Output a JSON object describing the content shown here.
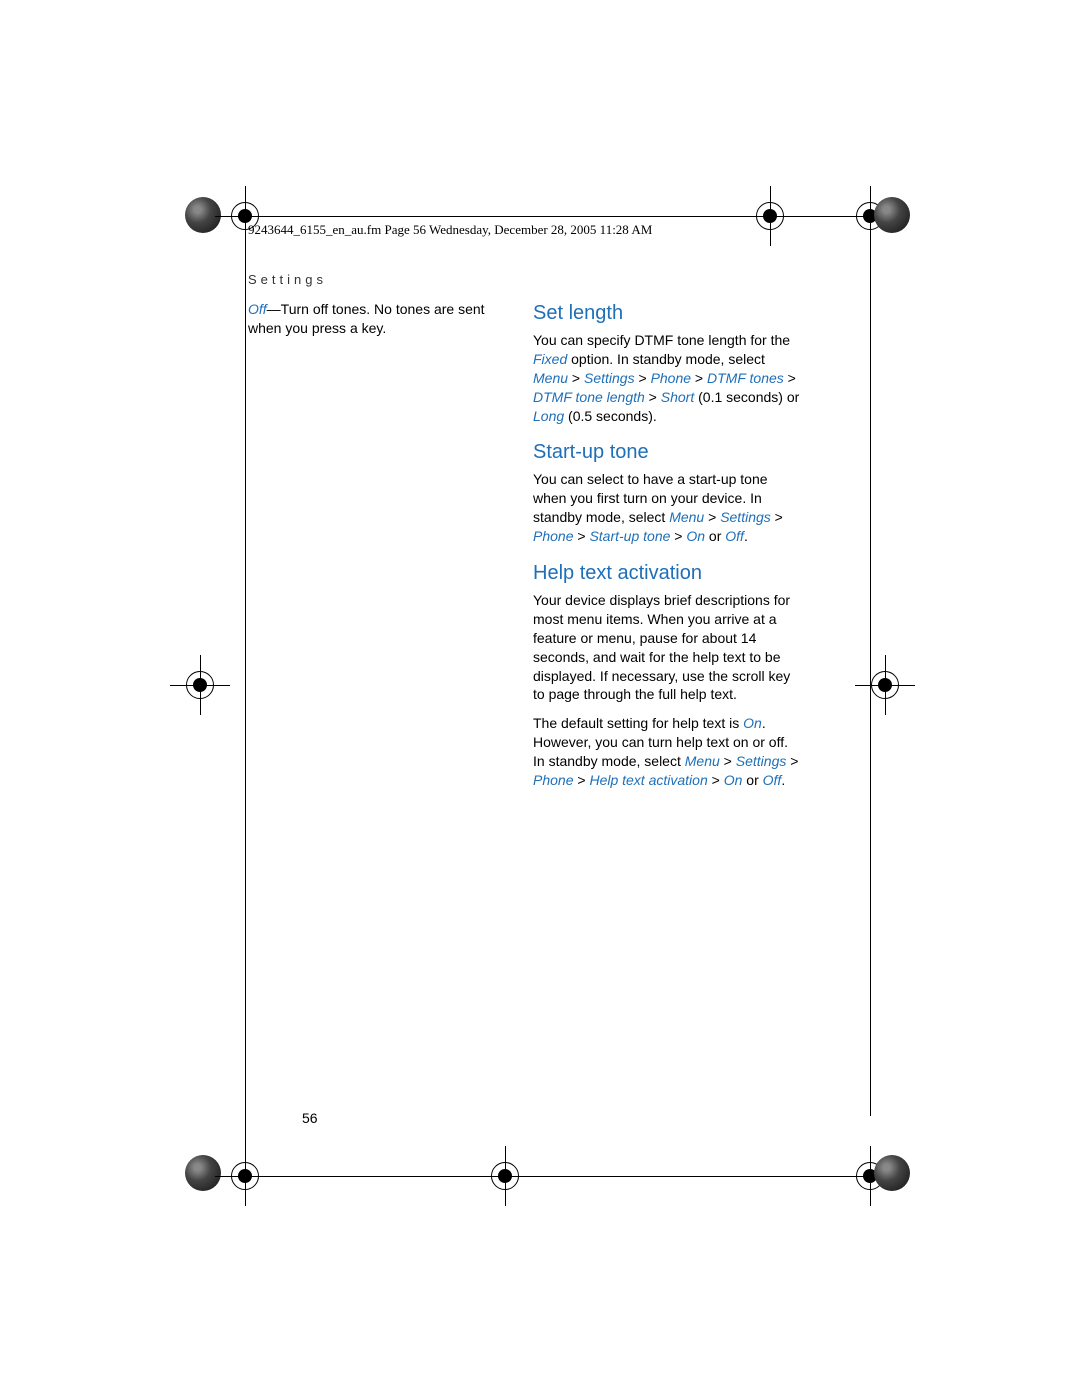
{
  "header": "9243644_6155_en_au.fm  Page 56  Wednesday, December 28, 2005  11:28 AM",
  "section": "Settings",
  "left_col": {
    "off_label": "Off",
    "off_text": "—Turn off tones. No tones are sent when you press a key."
  },
  "right_col": {
    "set_length": {
      "heading": "Set length",
      "text1": "You can specify DTMF tone length for the ",
      "fixed": "Fixed",
      "text2": " option. In standby mode, select ",
      "path1": "Menu",
      "gt1": " > ",
      "path2": "Settings",
      "gt2": " > ",
      "path3": "Phone",
      "gt3": " > ",
      "path4": "DTMF tones",
      "gt4": " > ",
      "path5": "DTMF tone length",
      "gt5": " > ",
      "path6": "Short",
      "text3": " (0.1 seconds) or ",
      "path7": "Long",
      "text4": " (0.5 seconds)."
    },
    "startup": {
      "heading": "Start-up tone",
      "text1": "You can select to have a start-up tone when you first turn on your device. In standby mode, select ",
      "path1": "Menu",
      "gt1": " > ",
      "path2": "Settings",
      "gt2": " > ",
      "path3": "Phone",
      "gt3": " > ",
      "path4": "Start-up tone",
      "gt4": " > ",
      "path5": "On",
      "text2": " or ",
      "path6": "Off",
      "text3": "."
    },
    "help": {
      "heading": "Help text activation",
      "para1": "Your device displays brief descriptions for most menu items. When you arrive at a feature or menu, pause for about 14 seconds, and wait for the help text to be displayed. If necessary, use the scroll key to page through the full help text.",
      "text1": "The default setting for help text is ",
      "on1": "On",
      "text2": ". However, you can turn help text on or off. In standby mode, select ",
      "path1": "Menu",
      "gt1": " > ",
      "path2": "Settings",
      "gt2": " > ",
      "path3": "Phone",
      "gt3": " > ",
      "path4": "Help text activation",
      "gt4": " > ",
      "path5": "On",
      "text3": " or ",
      "path6": "Off",
      "text4": "."
    }
  },
  "page_number": "56"
}
